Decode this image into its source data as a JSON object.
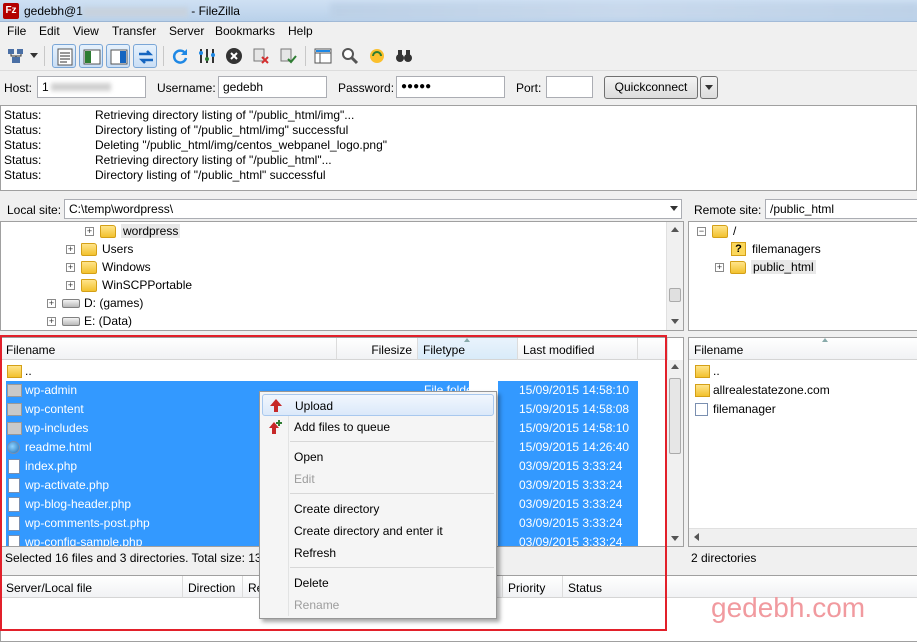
{
  "window": {
    "title_prefix": "gedebh@1",
    "title_suffix": " - FileZilla"
  },
  "menu": [
    "File",
    "Edit",
    "View",
    "Transfer",
    "Server",
    "Bookmarks",
    "Help"
  ],
  "quickconnect": {
    "host_label": "Host:",
    "host_value": "1",
    "username_label": "Username:",
    "username_value": "gedebh",
    "password_label": "Password:",
    "password_value": "●●●●●",
    "port_label": "Port:",
    "port_value": "",
    "button": "Quickconnect"
  },
  "log": [
    {
      "label": "Status:",
      "text": "Retrieving directory listing of \"/public_html/img\"..."
    },
    {
      "label": "Status:",
      "text": "Directory listing of \"/public_html/img\" successful"
    },
    {
      "label": "Status:",
      "text": "Deleting \"/public_html/img/centos_webpanel_logo.png\""
    },
    {
      "label": "Status:",
      "text": "Retrieving directory listing of \"/public_html\"..."
    },
    {
      "label": "Status:",
      "text": "Directory listing of \"/public_html\" successful"
    }
  ],
  "local": {
    "site_label": "Local site:",
    "path": "C:\\temp\\wordpress\\",
    "tree": [
      "wordpress",
      "Users",
      "Windows",
      "WinSCPPortable",
      "D: (games)",
      "E: (Data)"
    ],
    "columns": [
      "Filename",
      "Filesize",
      "Filetype",
      "Last modified"
    ],
    "files": [
      {
        "name": "..",
        "size": "",
        "type": "",
        "modified": ""
      },
      {
        "name": "wp-admin",
        "size": "",
        "type": "File folder",
        "modified": "15/09/2015 14:58:10"
      },
      {
        "name": "wp-content",
        "size": "",
        "type": "File folder",
        "modified": "15/09/2015 14:58:08"
      },
      {
        "name": "wp-includes",
        "size": "",
        "type": "File folder",
        "modified": "15/09/2015 14:58:10"
      },
      {
        "name": "readme.html",
        "size": "",
        "type": "",
        "modified": "15/09/2015 14:26:40"
      },
      {
        "name": "index.php",
        "size": "",
        "type": "",
        "modified": "03/09/2015 3:33:24"
      },
      {
        "name": "wp-activate.php",
        "size": "",
        "type": "",
        "modified": "03/09/2015 3:33:24"
      },
      {
        "name": "wp-blog-header.php",
        "size": "",
        "type": "",
        "modified": "03/09/2015 3:33:24"
      },
      {
        "name": "wp-comments-post.php",
        "size": "",
        "type": "",
        "modified": "03/09/2015 3:33:24"
      },
      {
        "name": "wp-config-sample.php",
        "size": "",
        "type": "",
        "modified": "03/09/2015 3:33:24"
      }
    ],
    "status": "Selected 16 files and 3 directories. Total size: 135."
  },
  "remote": {
    "site_label": "Remote site:",
    "path": "/public_html",
    "tree": [
      "/",
      "filemanagers",
      "public_html"
    ],
    "columns": [
      "Filename"
    ],
    "files": [
      "..",
      "allrealestatezone.com",
      "filemanager"
    ],
    "status": "2 directories"
  },
  "queue": {
    "columns": [
      "Server/Local file",
      "Direction",
      "Re",
      "Priority",
      "Status"
    ]
  },
  "context_menu": {
    "upload": "Upload",
    "add_to_queue": "Add files to queue",
    "open": "Open",
    "edit": "Edit",
    "create_directory": "Create directory",
    "create_directory_enter": "Create directory and enter it",
    "refresh": "Refresh",
    "delete": "Delete",
    "rename": "Rename"
  },
  "watermark": "gedebh.com",
  "colors": {
    "selection": "#3399ff",
    "highlight_box": "#e2202a",
    "watermark": "#f19a9f"
  }
}
